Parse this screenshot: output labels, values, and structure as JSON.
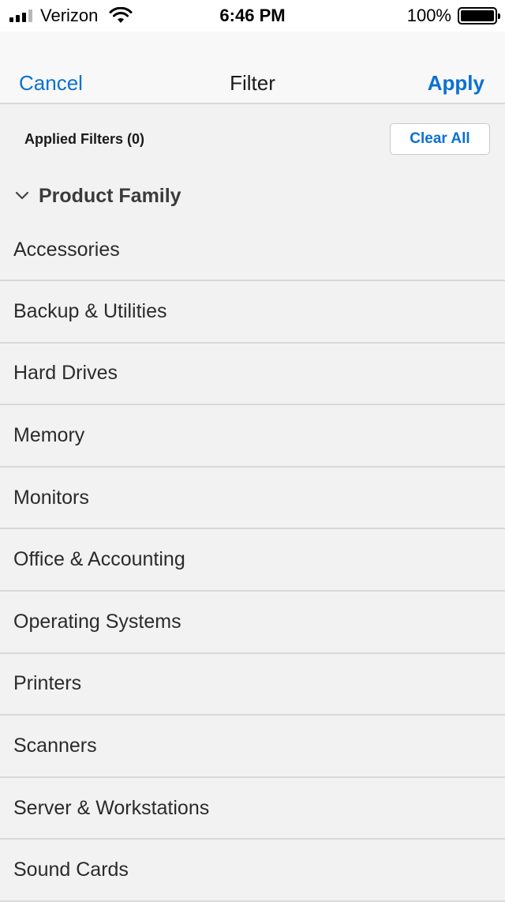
{
  "status_bar": {
    "carrier": "Verizon",
    "time": "6:46 PM",
    "battery": "100%",
    "battery_level": 1.0,
    "signal_bars": 3,
    "signal_max": 4
  },
  "nav": {
    "cancel_label": "Cancel",
    "title": "Filter",
    "apply_label": "Apply"
  },
  "applied": {
    "label": "Applied Filters (0)",
    "clear_label": "Clear All"
  },
  "section": {
    "title": "Product Family",
    "expanded": true,
    "items": [
      {
        "label": "Accessories"
      },
      {
        "label": "Backup & Utilities"
      },
      {
        "label": "Hard Drives"
      },
      {
        "label": "Memory"
      },
      {
        "label": "Monitors"
      },
      {
        "label": "Office & Accounting"
      },
      {
        "label": "Operating Systems"
      },
      {
        "label": "Printers"
      },
      {
        "label": "Scanners"
      },
      {
        "label": "Server & Workstations"
      },
      {
        "label": "Sound Cards"
      }
    ]
  },
  "colors": {
    "accent": "#0a70d2",
    "background": "#f2f2f2",
    "divider": "#d8d8d8"
  },
  "icons": {
    "signal": "cellular-signal-icon",
    "wifi": "wifi-icon",
    "battery": "battery-icon",
    "chevron": "chevron-down-icon"
  }
}
